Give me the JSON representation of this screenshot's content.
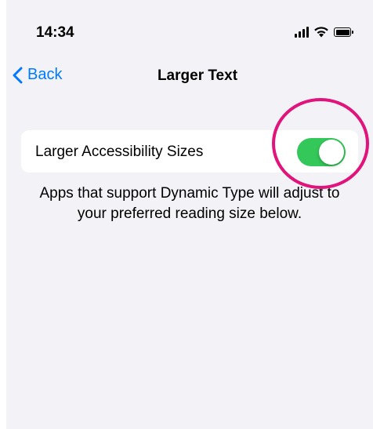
{
  "status_bar": {
    "time": "14:34"
  },
  "nav": {
    "back_label": "Back",
    "title": "Larger Text"
  },
  "settings": {
    "larger_accessibility_sizes": {
      "label": "Larger Accessibility Sizes",
      "enabled": true
    },
    "footer": "Apps that support Dynamic Type will adjust to your preferred reading size below."
  },
  "colors": {
    "accent": "#007aff",
    "toggle_on": "#34c759",
    "annotation": "#e0147a",
    "background": "#f2f2f7"
  },
  "icons": {
    "back": "chevron-left-icon",
    "signal": "cellular-signal-icon",
    "wifi": "wifi-icon",
    "battery": "battery-icon"
  }
}
